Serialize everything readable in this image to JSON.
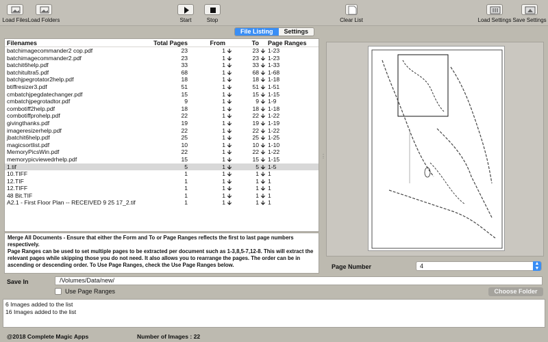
{
  "toolbar": {
    "load_files": "Load Files",
    "load_folders": "Load Folders",
    "start": "Start",
    "stop": "Stop",
    "clear_list": "Clear List",
    "load_settings": "Load Settings",
    "save_settings": "Save Settings"
  },
  "tabs": {
    "file_listing": "File Listing",
    "settings": "Settings"
  },
  "columns": {
    "filenames": "Filenames",
    "total_pages": "Total Pages",
    "from": "From",
    "to": "To",
    "page_ranges": "Page Ranges"
  },
  "files": [
    {
      "name": "batchimagecommander2 cop.pdf",
      "total": "23",
      "from": "1",
      "to": "23",
      "range": "1-23"
    },
    {
      "name": "batchimagecommander2.pdf",
      "total": "23",
      "from": "1",
      "to": "23",
      "range": "1-23"
    },
    {
      "name": "batchit6help.pdf",
      "total": "33",
      "from": "1",
      "to": "33",
      "range": "1-33"
    },
    {
      "name": "batchitultra5.pdf",
      "total": "68",
      "from": "1",
      "to": "68",
      "range": "1-68"
    },
    {
      "name": "batchjpegrotator2help.pdf",
      "total": "18",
      "from": "1",
      "to": "18",
      "range": "1-18"
    },
    {
      "name": "btiffresizer3.pdf",
      "total": "51",
      "from": "1",
      "to": "51",
      "range": "1-51"
    },
    {
      "name": "cmbatchjpegdatechanger.pdf",
      "total": "15",
      "from": "1",
      "to": "15",
      "range": "1-15"
    },
    {
      "name": "cmbatchjpegrotadtor.pdf",
      "total": "9",
      "from": "1",
      "to": "9",
      "range": "1-9"
    },
    {
      "name": "combotiff2help.pdf",
      "total": "18",
      "from": "1",
      "to": "18",
      "range": "1-18"
    },
    {
      "name": "combotiffprohelp.pdf",
      "total": "22",
      "from": "1",
      "to": "22",
      "range": "1-22"
    },
    {
      "name": "givingthanks.pdf",
      "total": "19",
      "from": "1",
      "to": "19",
      "range": "1-19"
    },
    {
      "name": "imageresizerhelp.pdf",
      "total": "22",
      "from": "1",
      "to": "22",
      "range": "1-22"
    },
    {
      "name": "jbatchit6help.pdf",
      "total": "25",
      "from": "1",
      "to": "25",
      "range": "1-25"
    },
    {
      "name": "magicsortlist.pdf",
      "total": "10",
      "from": "1",
      "to": "10",
      "range": "1-10"
    },
    {
      "name": "MemoryPicsWin.pdf",
      "total": "22",
      "from": "1",
      "to": "22",
      "range": "1-22"
    },
    {
      "name": "memorypicviewedrhelp.pdf",
      "total": "15",
      "from": "1",
      "to": "15",
      "range": "1-15"
    },
    {
      "name": "1.tif",
      "total": "5",
      "from": "1",
      "to": "5",
      "range": "1-5",
      "selected": true
    },
    {
      "name": "10.TIFF",
      "total": "1",
      "from": "1",
      "to": "1",
      "range": "1"
    },
    {
      "name": "12.TIF",
      "total": "1",
      "from": "1",
      "to": "1",
      "range": "1"
    },
    {
      "name": "12.TIFF",
      "total": "1",
      "from": "1",
      "to": "1",
      "range": "1"
    },
    {
      "name": "48 Bit.TIF",
      "total": "1",
      "from": "1",
      "to": "1",
      "range": "1"
    },
    {
      "name": "A2.1 - First Floor Plan -- RECEIVED 9 25 17_2.tif",
      "total": "1",
      "from": "1",
      "to": "1",
      "range": "1"
    }
  ],
  "info": {
    "line1": "Merge All Documents - Ensure that either the Form and To or Page Ranges reflects the first to last page numbers respectively.",
    "line2": "Page Ranges can be used to set multiple pages to be extracted per document such as 1-3,8,5-7,12-8. This will extract the relevant pages while skipping those you do not need. It also allows you to rearrange the pages. The order can be in ascending or descending order. To Use Page Ranges, check the Use Page Ranges below."
  },
  "page_number": {
    "label": "Page Number",
    "value": "4"
  },
  "save_in": {
    "label": "Save In",
    "path": "/Volumes/Data/new/"
  },
  "use_page_ranges": "Use Page Ranges",
  "choose_folder": "Choose Folder",
  "log": [
    "6 Images added to the list",
    "16 Images added to the list"
  ],
  "footer": {
    "copyright": "@2018 Complete Magic Apps",
    "image_count": "Number of Images : 22"
  },
  "colors": {
    "accent": "#3a8ef5",
    "window_bg": "#bdbab0",
    "selected_row": "#d8d8d8"
  }
}
